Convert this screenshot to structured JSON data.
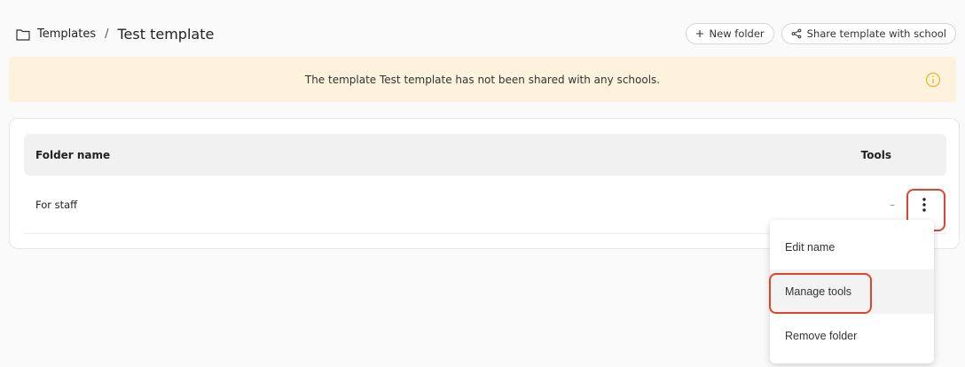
{
  "breadcrumb": {
    "root": "Templates",
    "separator": "/",
    "current": "Test template"
  },
  "actions": {
    "new_folder": "New folder",
    "share": "Share template with school"
  },
  "banner": {
    "message": "The template Test template has not been shared with any schools."
  },
  "table": {
    "headers": {
      "name": "Folder name",
      "tools": "Tools"
    },
    "rows": [
      {
        "name": "For staff",
        "tools": "–"
      }
    ]
  },
  "menu": {
    "items": [
      "Edit name",
      "Manage tools",
      "Remove folder"
    ]
  },
  "colors": {
    "banner_bg": "#fdf3dc",
    "info_accent": "#f0b429",
    "highlight": "#e0442d"
  }
}
